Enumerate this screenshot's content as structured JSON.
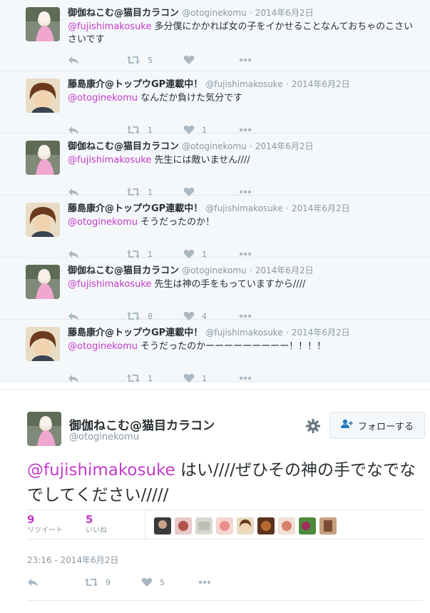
{
  "colors": {
    "mention": "#c23bc8",
    "meta": "#8899a6",
    "background_thread": "#f5f8fa"
  },
  "thread": [
    {
      "name": "御伽ねこむ@猫目カラコン",
      "handle": "@otoginekomu",
      "sep": "·",
      "date": "2014年6月2日",
      "mention": "@fujishimakosuke",
      "text": " 多分僕にかかれば女の子をイかせることなんておちゃのこさいさいです",
      "retweets": "5",
      "likes": "",
      "avatar": "otogi"
    },
    {
      "name": "藤島康介@トップウGP連載中！",
      "handle": "@fujishimakosuke",
      "sep": "·",
      "date": "2014年6月2日",
      "mention": "@otoginekomu",
      "text": " なんだか負けた気分です",
      "retweets": "1",
      "likes": "1",
      "avatar": "fuji"
    },
    {
      "name": "御伽ねこむ@猫目カラコン",
      "handle": "@otoginekomu",
      "sep": "·",
      "date": "2014年6月2日",
      "mention": "@fujishimakosuke",
      "text": " 先生には敵いません////",
      "retweets": "1",
      "likes": "",
      "avatar": "otogi"
    },
    {
      "name": "藤島康介@トップウGP連載中！",
      "handle": "@fujishimakosuke",
      "sep": "·",
      "date": "2014年6月2日",
      "mention": "@otoginekomu",
      "text": " そうだったのか！",
      "retweets": "1",
      "likes": "1",
      "avatar": "fuji"
    },
    {
      "name": "御伽ねこむ@猫目カラコン",
      "handle": "@otoginekomu",
      "sep": "·",
      "date": "2014年6月2日",
      "mention": "@fujishimakosuke",
      "text": " 先生は神の手をもっていますから////",
      "retweets": "8",
      "likes": "4",
      "avatar": "otogi"
    },
    {
      "name": "藤島康介@トップウGP連載中！",
      "handle": "@fujishimakosuke",
      "sep": "·",
      "date": "2014年6月2日",
      "mention": "@otoginekomu",
      "text": " そうだったのかーーーーーーーーー！！！！",
      "retweets": "1",
      "likes": "1",
      "avatar": "fuji"
    }
  ],
  "main": {
    "name": "御伽ねこむ@猫目カラコン",
    "handle": "@otoginekomu",
    "follow_label": "フォローする",
    "mention": "@fujishimakosuke",
    "text": " はい////ぜひその神の手でなでなでしてください/////",
    "retweet_count": "9",
    "retweet_label": "リツイート",
    "like_count": "5",
    "like_label": "いいね",
    "timestamp": "23:16 - 2014年6月2日",
    "action_retweets": "9",
    "action_likes": "5",
    "liker_count": 9
  },
  "icons": [
    "reply-icon",
    "retweet-icon",
    "heart-icon",
    "more-icon",
    "gear-icon",
    "follow-person-icon"
  ]
}
